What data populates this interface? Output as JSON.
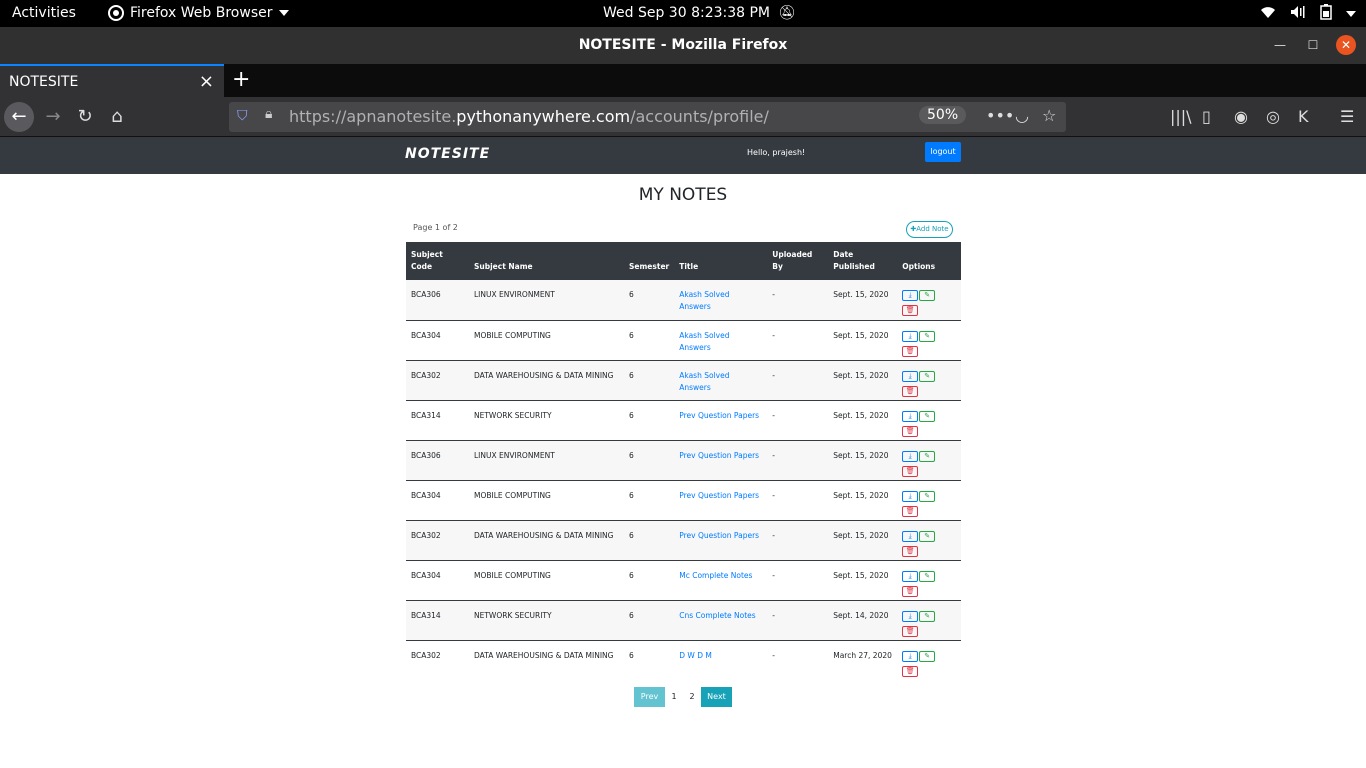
{
  "system_bar": {
    "activities": "Activities",
    "app_name": "Firefox Web Browser",
    "clock": "Wed Sep 30   8:23:38 PM"
  },
  "window": {
    "title": "NOTESITE - Mozilla Firefox"
  },
  "tabs": [
    {
      "label": "NOTESITE",
      "active": true
    }
  ],
  "urlbar": {
    "url_prefix": "https://apnanotesite.",
    "url_domain": "pythonanywhere.com",
    "url_path": "/accounts/profile/",
    "zoom": "50%"
  },
  "site": {
    "brand": "NOTESITE",
    "greeting": "Hello, prajesh!",
    "logout_label": "logout",
    "page_title": "MY NOTES",
    "page_info": "Page 1 of 2",
    "add_note_label": "Add Note"
  },
  "table": {
    "headers": [
      "Subject Code",
      "Subject Name",
      "Semester",
      "Title",
      "Uploaded By",
      "Date Published",
      "Options"
    ],
    "rows": [
      {
        "code": "BCA306",
        "name": "LINUX ENVIRONMENT",
        "semester": "6",
        "title": "Akash Solved Answers",
        "uploaded_by": "-",
        "date": "Sept. 15, 2020"
      },
      {
        "code": "BCA304",
        "name": "MOBILE COMPUTING",
        "semester": "6",
        "title": "Akash Solved Answers",
        "uploaded_by": "-",
        "date": "Sept. 15, 2020"
      },
      {
        "code": "BCA302",
        "name": "DATA WAREHOUSING & DATA MINING",
        "semester": "6",
        "title": "Akash Solved Answers",
        "uploaded_by": "-",
        "date": "Sept. 15, 2020"
      },
      {
        "code": "BCA314",
        "name": "NETWORK SECURITY",
        "semester": "6",
        "title": "Prev Question Papers",
        "uploaded_by": "-",
        "date": "Sept. 15, 2020"
      },
      {
        "code": "BCA306",
        "name": "LINUX ENVIRONMENT",
        "semester": "6",
        "title": "Prev Question Papers",
        "uploaded_by": "-",
        "date": "Sept. 15, 2020"
      },
      {
        "code": "BCA304",
        "name": "MOBILE COMPUTING",
        "semester": "6",
        "title": "Prev Question Papers",
        "uploaded_by": "-",
        "date": "Sept. 15, 2020"
      },
      {
        "code": "BCA302",
        "name": "DATA WAREHOUSING & DATA MINING",
        "semester": "6",
        "title": "Prev Question Papers",
        "uploaded_by": "-",
        "date": "Sept. 15, 2020"
      },
      {
        "code": "BCA304",
        "name": "MOBILE COMPUTING",
        "semester": "6",
        "title": "Mc Complete Notes",
        "uploaded_by": "-",
        "date": "Sept. 15, 2020"
      },
      {
        "code": "BCA314",
        "name": "NETWORK SECURITY",
        "semester": "6",
        "title": "Cns Complete Notes",
        "uploaded_by": "-",
        "date": "Sept. 14, 2020"
      },
      {
        "code": "BCA302",
        "name": "DATA WAREHOUSING & DATA MINING",
        "semester": "6",
        "title": "D W D M",
        "uploaded_by": "-",
        "date": "March 27, 2020"
      }
    ]
  },
  "pagination": {
    "prev": "Prev",
    "pages": [
      "1",
      "2"
    ],
    "next": "Next"
  },
  "colors": {
    "navbar": "#343a40",
    "primary": "#007bff",
    "success": "#28a745",
    "danger": "#dc3545",
    "info": "#17a2b8"
  }
}
